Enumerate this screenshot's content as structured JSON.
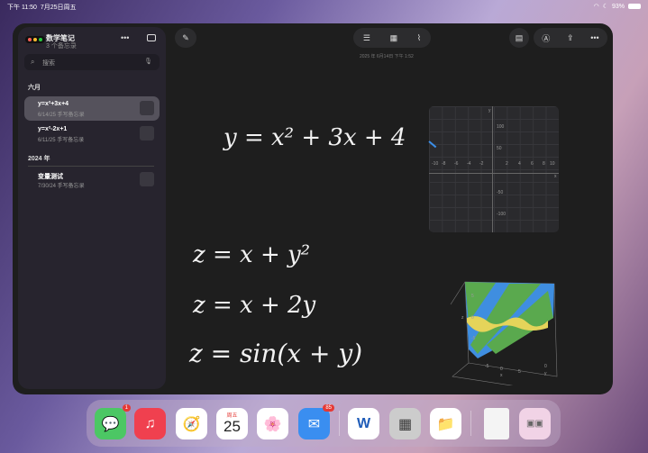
{
  "status_bar": {
    "time": "下午 11:50",
    "date": "7月25日周五",
    "battery": "93%"
  },
  "sidebar": {
    "title": "数学笔记",
    "subtitle": "3 个备忘录",
    "search_placeholder": "搜索",
    "sections": [
      {
        "label": "六月",
        "notes": [
          {
            "title": "y=x²+3x+4",
            "meta": "6/14/25  手写备忘录",
            "selected": true
          },
          {
            "title": "y=x²-2x+1",
            "meta": "6/11/25  手写备忘录"
          }
        ]
      },
      {
        "label": "2024 年",
        "notes": [
          {
            "title": "变量测试",
            "meta": "7/30/24  手写备忘录"
          }
        ]
      }
    ]
  },
  "note": {
    "date": "2025 年 6月14日 下午 1:52",
    "equations": [
      "y = x² + 3x + 4",
      "z = x + y²",
      "z = x + 2y",
      "z = sin(x + y)"
    ]
  },
  "graph2d": {
    "x_ticks": [
      "-10",
      "-8",
      "-6",
      "-4",
      "-2",
      "2",
      "4",
      "6",
      "8",
      "10"
    ],
    "y_ticks": [
      "100",
      "50",
      "-50",
      "-100"
    ],
    "x_label": "x",
    "y_label": "y"
  },
  "graph3d": {
    "z_ticks": [
      "5",
      "0",
      "-5"
    ],
    "x_ticks": [
      "-5",
      "0",
      "5"
    ],
    "y_tick": "0",
    "x_label": "x",
    "y_label": "y",
    "z_label": "z"
  },
  "dock": {
    "calendar_day": "周五",
    "calendar_date": "25",
    "badges": {
      "messages": "1",
      "mail": "85"
    }
  }
}
